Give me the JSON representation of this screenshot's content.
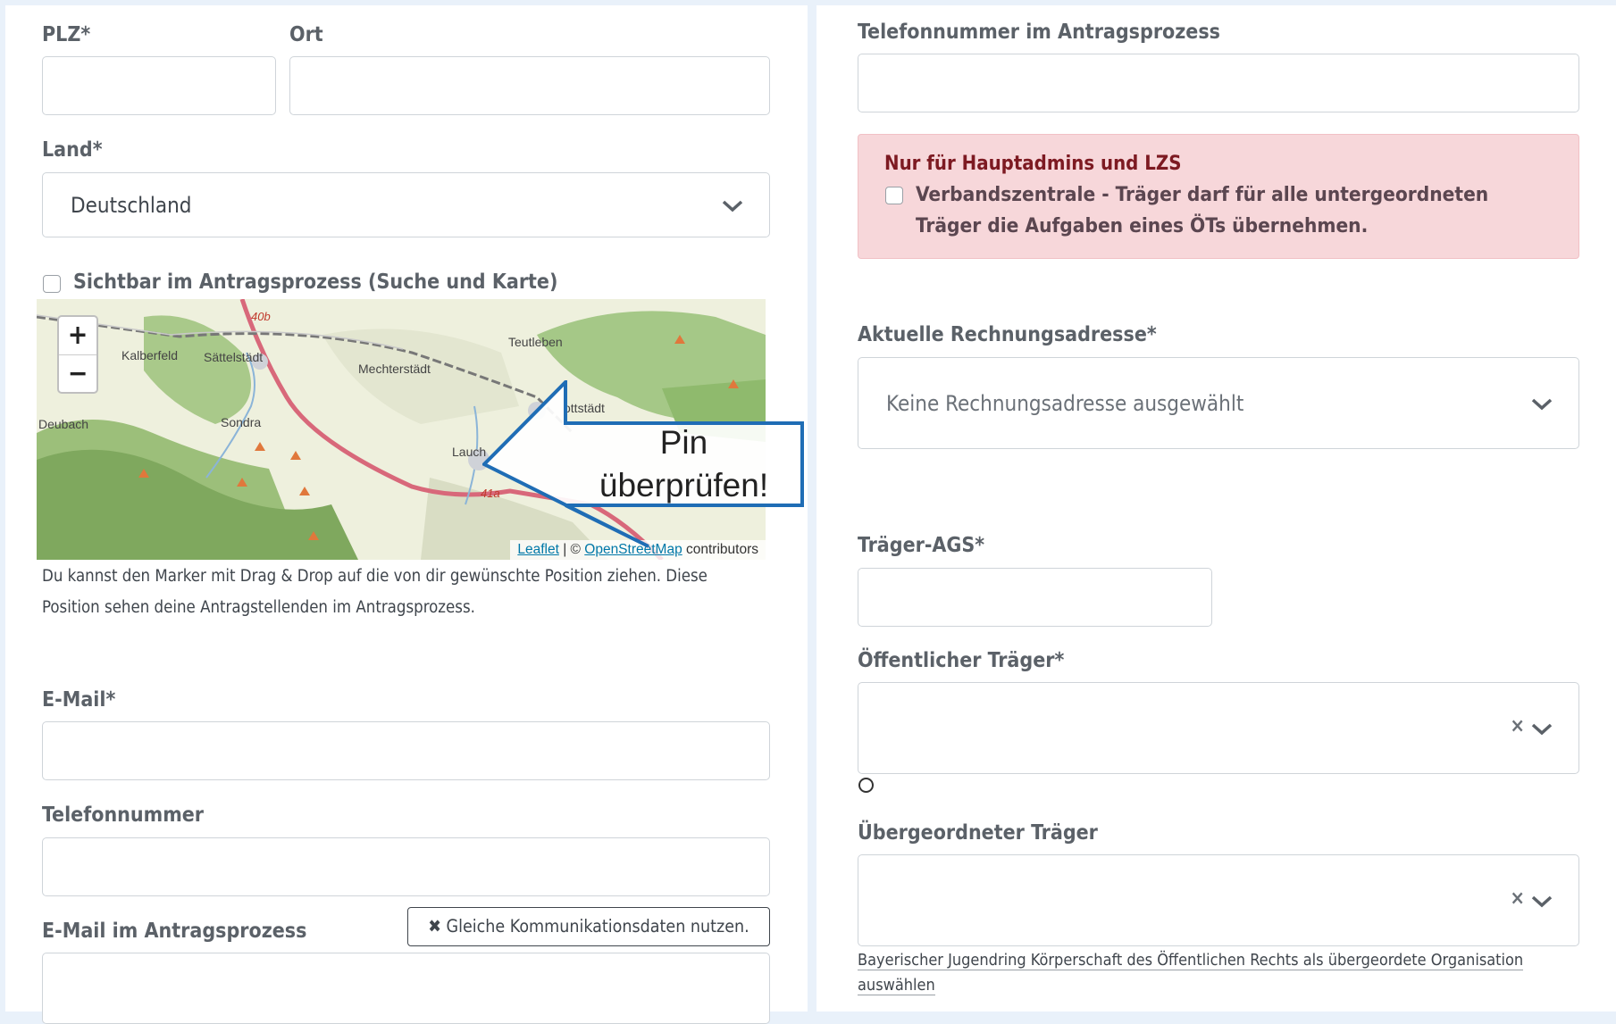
{
  "left": {
    "plz_label": "PLZ*",
    "ort_label": "Ort",
    "land_label": "Land*",
    "land_value": "Deutschland",
    "visible_checkbox_label": "Sichtbar im Antragsprozess (Suche und Karte)",
    "map": {
      "zoom_in": "+",
      "zoom_out": "−",
      "attribution_leaflet": "Leaflet",
      "attribution_sep": " | © ",
      "attribution_osm": "OpenStreetMap",
      "attribution_rest": " contributors",
      "places": [
        "Kalberfeld",
        "Sättelstädt",
        "Mechterstädt",
        "Teutleben",
        "Deubach",
        "Sondra",
        "Lauch",
        "ottstädt",
        "40b",
        "41a"
      ]
    },
    "map_help": "Du kannst den Marker mit Drag & Drop auf die von dir gewünschte Position ziehen. Diese Position sehen deine Antragstellenden im Antragsprozess.",
    "email_label": "E-Mail*",
    "phone_label": "Telefonnummer",
    "email_process_label": "E-Mail im Antragsprozess",
    "same_data_button": "✖ Gleiche Kommunikationsdaten nutzen."
  },
  "right": {
    "phone_process_label": "Telefonnummer im Antragsprozess",
    "alert_title": "Nur für Hauptadmins und LZS",
    "alert_checkbox_label": "Verbandszentrale - Träger darf für alle untergeordneten Träger die Aufgaben eines ÖTs übernehmen.",
    "billing_label": "Aktuelle Rechnungsadresse*",
    "billing_placeholder": "Keine Rechnungsadresse ausgewählt",
    "ags_label": "Träger-AGS*",
    "public_label": "Öffentlicher Träger*",
    "parent_label": "Übergeordneter Träger",
    "parent_note": "Bayerischer Jugendring Körperschaft des Öffentlichen Rechts als übergeordete Organisation auswählen",
    "clear": "×"
  },
  "callout": {
    "line1": "Pin",
    "line2": "überprüfen!",
    "color": "#1f6db5"
  }
}
